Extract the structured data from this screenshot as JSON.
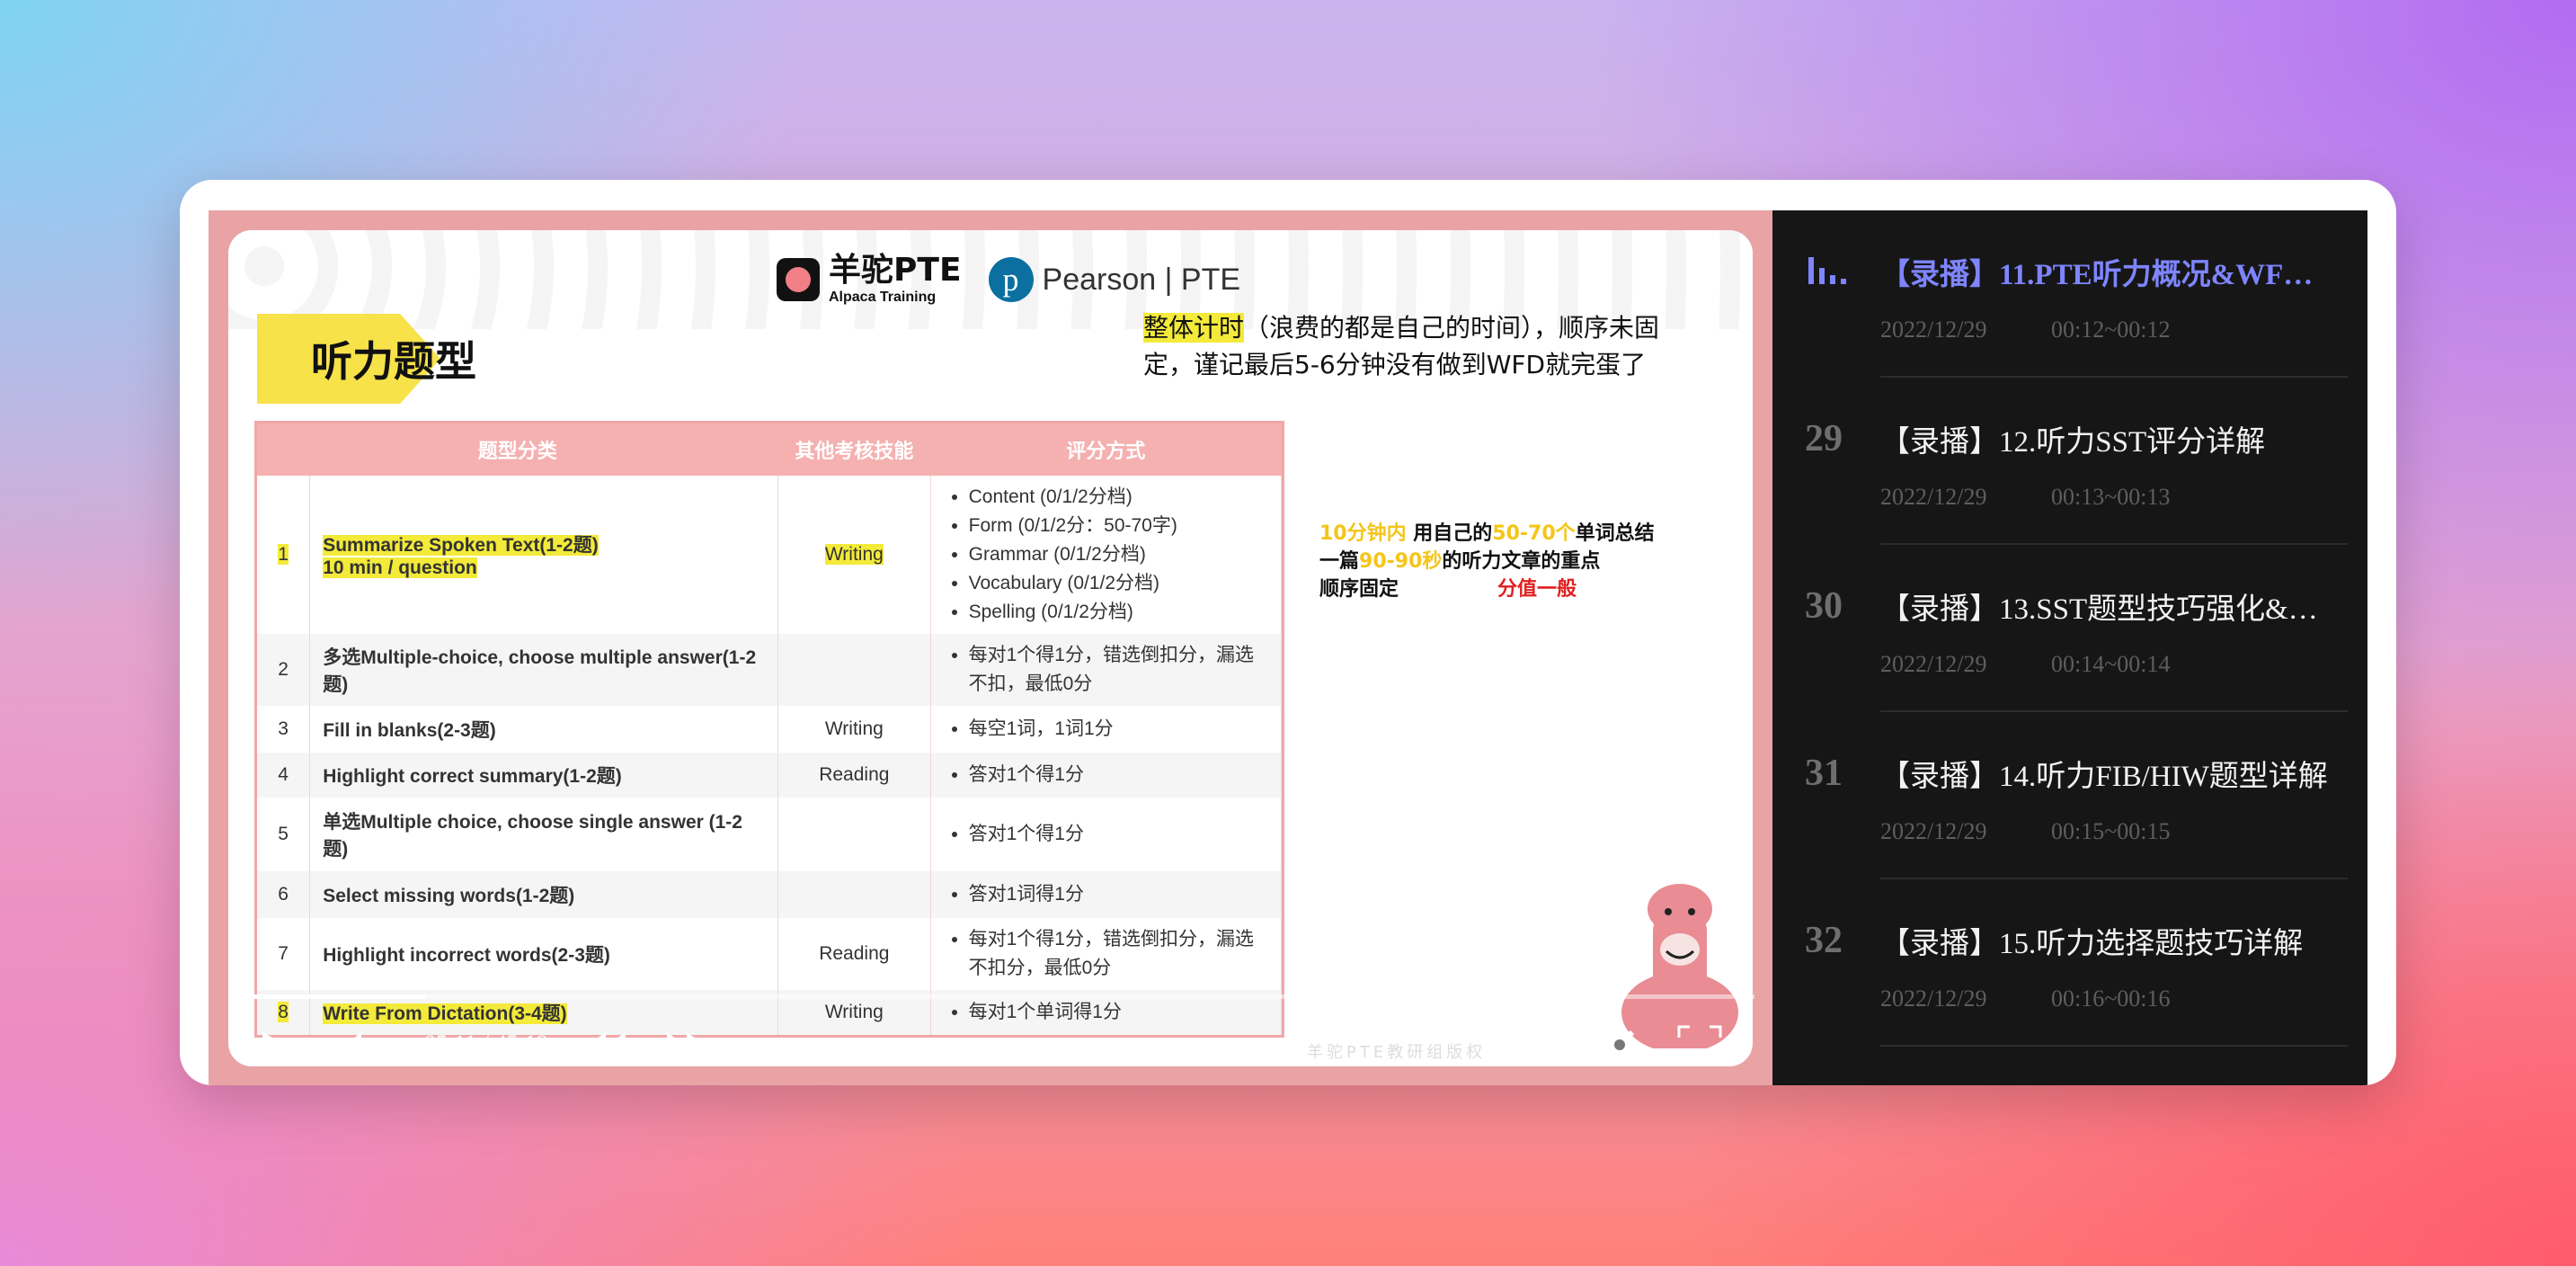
{
  "slide": {
    "heading": "听力题型",
    "alpaca_logo_title": "羊驼PTE",
    "alpaca_logo_sub": "Alpaca Training",
    "pearson_logo": "Pearson | PTE",
    "note_top_highlight": "整体计时",
    "note_top_rest": "（浪费的都是自己的时间），顺序未固定，谨记最后5-6分钟没有做到WFD就完蛋了",
    "note_mid": {
      "p1_yellow": "10分钟内",
      "p1_black": " 用自己的",
      "p1_yellow2": "50-70个",
      "p1_black2": "单词总结",
      "p2_black": "一篇",
      "p2_yellow": "90-90秒",
      "p2_black2": "的听力文章的重点",
      "p3_black": "顺序固定",
      "p3_red": "分值一般"
    },
    "table_headers": [
      "题型分类",
      "其他考核技能",
      "评分方式"
    ],
    "rows": [
      {
        "num": "1",
        "name": "Summarize Spoken Text(1-2题)",
        "name2": "10 min / question",
        "skill": "Writing",
        "methods": [
          "Content (0/1/2分档)",
          "Form (0/1/2分：50-70字)",
          "Grammar (0/1/2分档)",
          "Vocabulary (0/1/2分档)",
          "Spelling (0/1/2分档)"
        ]
      },
      {
        "num": "2",
        "name": "多选Multiple-choice, choose multiple answer(1-2题)",
        "name2": "",
        "skill": "",
        "methods": [
          "每对1个得1分，错选倒扣分，漏选不扣，最低0分"
        ]
      },
      {
        "num": "3",
        "name": "Fill in blanks(2-3题)",
        "name2": "",
        "skill": "Writing",
        "methods": [
          "每空1词，1词1分"
        ]
      },
      {
        "num": "4",
        "name": "Highlight correct summary(1-2题)",
        "name2": "",
        "skill": "Reading",
        "methods": [
          "答对1个得1分"
        ]
      },
      {
        "num": "5",
        "name": "单选Multiple choice, choose single answer (1-2题)",
        "name2": "",
        "skill": "",
        "methods": [
          "答对1个得1分"
        ]
      },
      {
        "num": "6",
        "name": "Select missing words(1-2题)",
        "name2": "",
        "skill": "",
        "methods": [
          "答对1词得1分"
        ]
      },
      {
        "num": "7",
        "name": "Highlight incorrect words(2-3题)",
        "name2": "",
        "skill": "Reading",
        "methods": [
          "每对1个得1分，错选倒扣分，漏选不扣分，最低0分"
        ]
      },
      {
        "num": "8",
        "name": "Write From Dictation(3-4题)",
        "name2": "",
        "skill": "Writing",
        "methods": [
          "每对1个单词得1分"
        ]
      }
    ],
    "watermark": "羊驼PTE教研组版权"
  },
  "player": {
    "time": "05:11 / 45:19",
    "progress_fraction": 0.115
  },
  "sidebar": {
    "items": [
      {
        "num": "",
        "title": "【录播】11.PTE听力概况&WFD…",
        "date": "2022/12/29",
        "range": "00:12~00:12",
        "active": true
      },
      {
        "num": "29",
        "title": "【录播】12.听力SST评分详解",
        "date": "2022/12/29",
        "range": "00:13~00:13",
        "active": false
      },
      {
        "num": "30",
        "title": "【录播】13.SST题型技巧强化&…",
        "date": "2022/12/29",
        "range": "00:14~00:14",
        "active": false
      },
      {
        "num": "31",
        "title": "【录播】14.听力FIB/HIW题型详解",
        "date": "2022/12/29",
        "range": "00:15~00:15",
        "active": false
      },
      {
        "num": "32",
        "title": "【录播】15.听力选择题技巧详解",
        "date": "2022/12/29",
        "range": "00:16~00:16",
        "active": false
      }
    ]
  },
  "colors": {
    "accent_playing": "#7e85ff",
    "highlight_yellow": "#f3ea3a",
    "table_header": "#f5b0b0",
    "sidebar_bg": "#161616"
  }
}
